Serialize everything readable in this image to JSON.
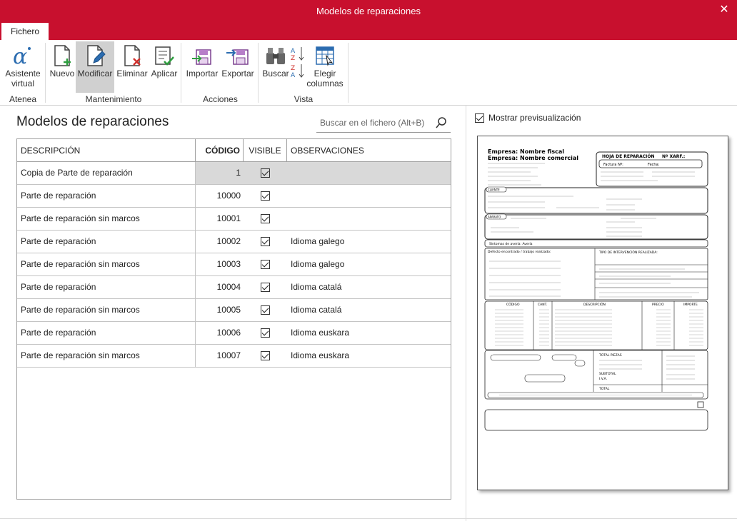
{
  "window": {
    "title": "Modelos de reparaciones",
    "close_glyph": "✕"
  },
  "tabs": [
    {
      "label": "Fichero"
    }
  ],
  "ribbon": {
    "buttons": {
      "asistente": "Asistente virtual",
      "nuevo": "Nuevo",
      "modificar": "Modificar",
      "eliminar": "Eliminar",
      "aplicar": "Aplicar",
      "importar": "Importar",
      "exportar": "Exportar",
      "buscar": "Buscar",
      "elegir": "Elegir columnas"
    },
    "groups": {
      "atenea": "Atenea",
      "mantenimiento": "Mantenimiento",
      "acciones": "Acciones",
      "vista": "Vista"
    },
    "colors": {
      "accent": "#c8102e",
      "blue": "#2b6cb0",
      "green": "#2e9e3f",
      "red": "#d0312d"
    }
  },
  "main": {
    "title": "Modelos de reparaciones",
    "search_placeholder": "Buscar en el fichero (Alt+B)",
    "columns": [
      "DESCRIPCIÓN",
      "CÓDIGO",
      "VISIBLE",
      "OBSERVACIONES"
    ],
    "rows": [
      {
        "desc": "Copia de Parte de reparación",
        "code": "1",
        "visible": true,
        "obs": "",
        "selected": true
      },
      {
        "desc": "Parte de reparación",
        "code": "10000",
        "visible": true,
        "obs": ""
      },
      {
        "desc": "Parte de reparación sin marcos",
        "code": "10001",
        "visible": true,
        "obs": ""
      },
      {
        "desc": "Parte de reparación",
        "code": "10002",
        "visible": true,
        "obs": "Idioma galego"
      },
      {
        "desc": "Parte de reparación sin marcos",
        "code": "10003",
        "visible": true,
        "obs": "Idioma galego"
      },
      {
        "desc": "Parte de reparación",
        "code": "10004",
        "visible": true,
        "obs": "Idioma catalá"
      },
      {
        "desc": "Parte de reparación sin marcos",
        "code": "10005",
        "visible": true,
        "obs": "Idioma catalá"
      },
      {
        "desc": "Parte de reparación",
        "code": "10006",
        "visible": true,
        "obs": "Idioma euskara"
      },
      {
        "desc": "Parte de reparación sin marcos",
        "code": "10007",
        "visible": true,
        "obs": "Idioma euskara"
      }
    ]
  },
  "preview": {
    "toggle_label": "Mostrar previsualización",
    "toggle_checked": true,
    "doc": {
      "empresa1": "Empresa: Nombre fiscal",
      "empresa2": "Empresa: Nombre comercial",
      "hoja": "HOJA DE REPARACIÓN",
      "numero": "Nº XARF.:",
      "factura": "Factura Nº:",
      "fecha": "Fecha:",
      "cliente": "CLIENTE",
      "aparato": "APARATO",
      "sintomas": "Síntomas de avería: Avería",
      "defecto": "Defecto encontrado / trabajo realizado:",
      "tipo": "TIPO DE INTERVENCIÓN REALIZADA:",
      "codigo": "CÓDIGO",
      "cant": "CANT.",
      "descripcion": "DESCRIPCIÓN",
      "precio": "PRECIO",
      "importe": "IMPORTE",
      "total_piezas": "TOTAL PIEZAS",
      "total": "TOTAL",
      "subtotal": "SUBTOTAL",
      "iva": "I.V.A."
    }
  }
}
